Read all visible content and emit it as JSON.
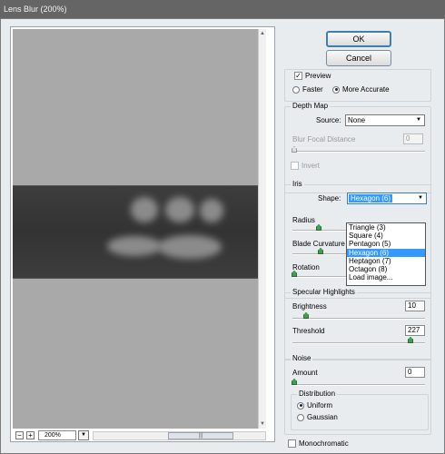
{
  "window": {
    "title": "Lens Blur (200%)"
  },
  "buttons": {
    "ok": "OK",
    "cancel": "Cancel"
  },
  "preview": {
    "preview_label": "Preview",
    "preview_checked": true,
    "faster_label": "Faster",
    "more_accurate_label": "More Accurate",
    "mode": "More Accurate"
  },
  "depth_map": {
    "title": "Depth Map",
    "source_label": "Source:",
    "source_value": "None",
    "focal_label": "Blur Focal Distance",
    "focal_value": "0",
    "invert_label": "Invert"
  },
  "iris": {
    "title": "Iris",
    "shape_label": "Shape:",
    "shape_value": "Hexagon (6)",
    "radius_label": "Radius",
    "blade_label": "Blade Curvature",
    "rotation_label": "Rotation",
    "shape_options": [
      "Triangle (3)",
      "Square (4)",
      "Pentagon (5)",
      "Hexagon (6)",
      "Heptagon (7)",
      "Octagon (8)",
      "Load image..."
    ],
    "selected_index": 3
  },
  "specular": {
    "title": "Specular Highlights",
    "brightness_label": "Brightness",
    "brightness_value": "10",
    "threshold_label": "Threshold",
    "threshold_value": "227"
  },
  "noise": {
    "title": "Noise",
    "amount_label": "Amount",
    "amount_value": "0",
    "distribution_title": "Distribution",
    "uniform_label": "Uniform",
    "gaussian_label": "Gaussian",
    "distribution": "Uniform",
    "mono_label": "Monochromatic"
  },
  "zoom": {
    "value": "200%",
    "minus": "−",
    "plus": "+"
  },
  "colors": {
    "accent": "#3399ff",
    "slider_thumb": "#3f9f4f",
    "preview_bg": "#a9a9a9"
  }
}
